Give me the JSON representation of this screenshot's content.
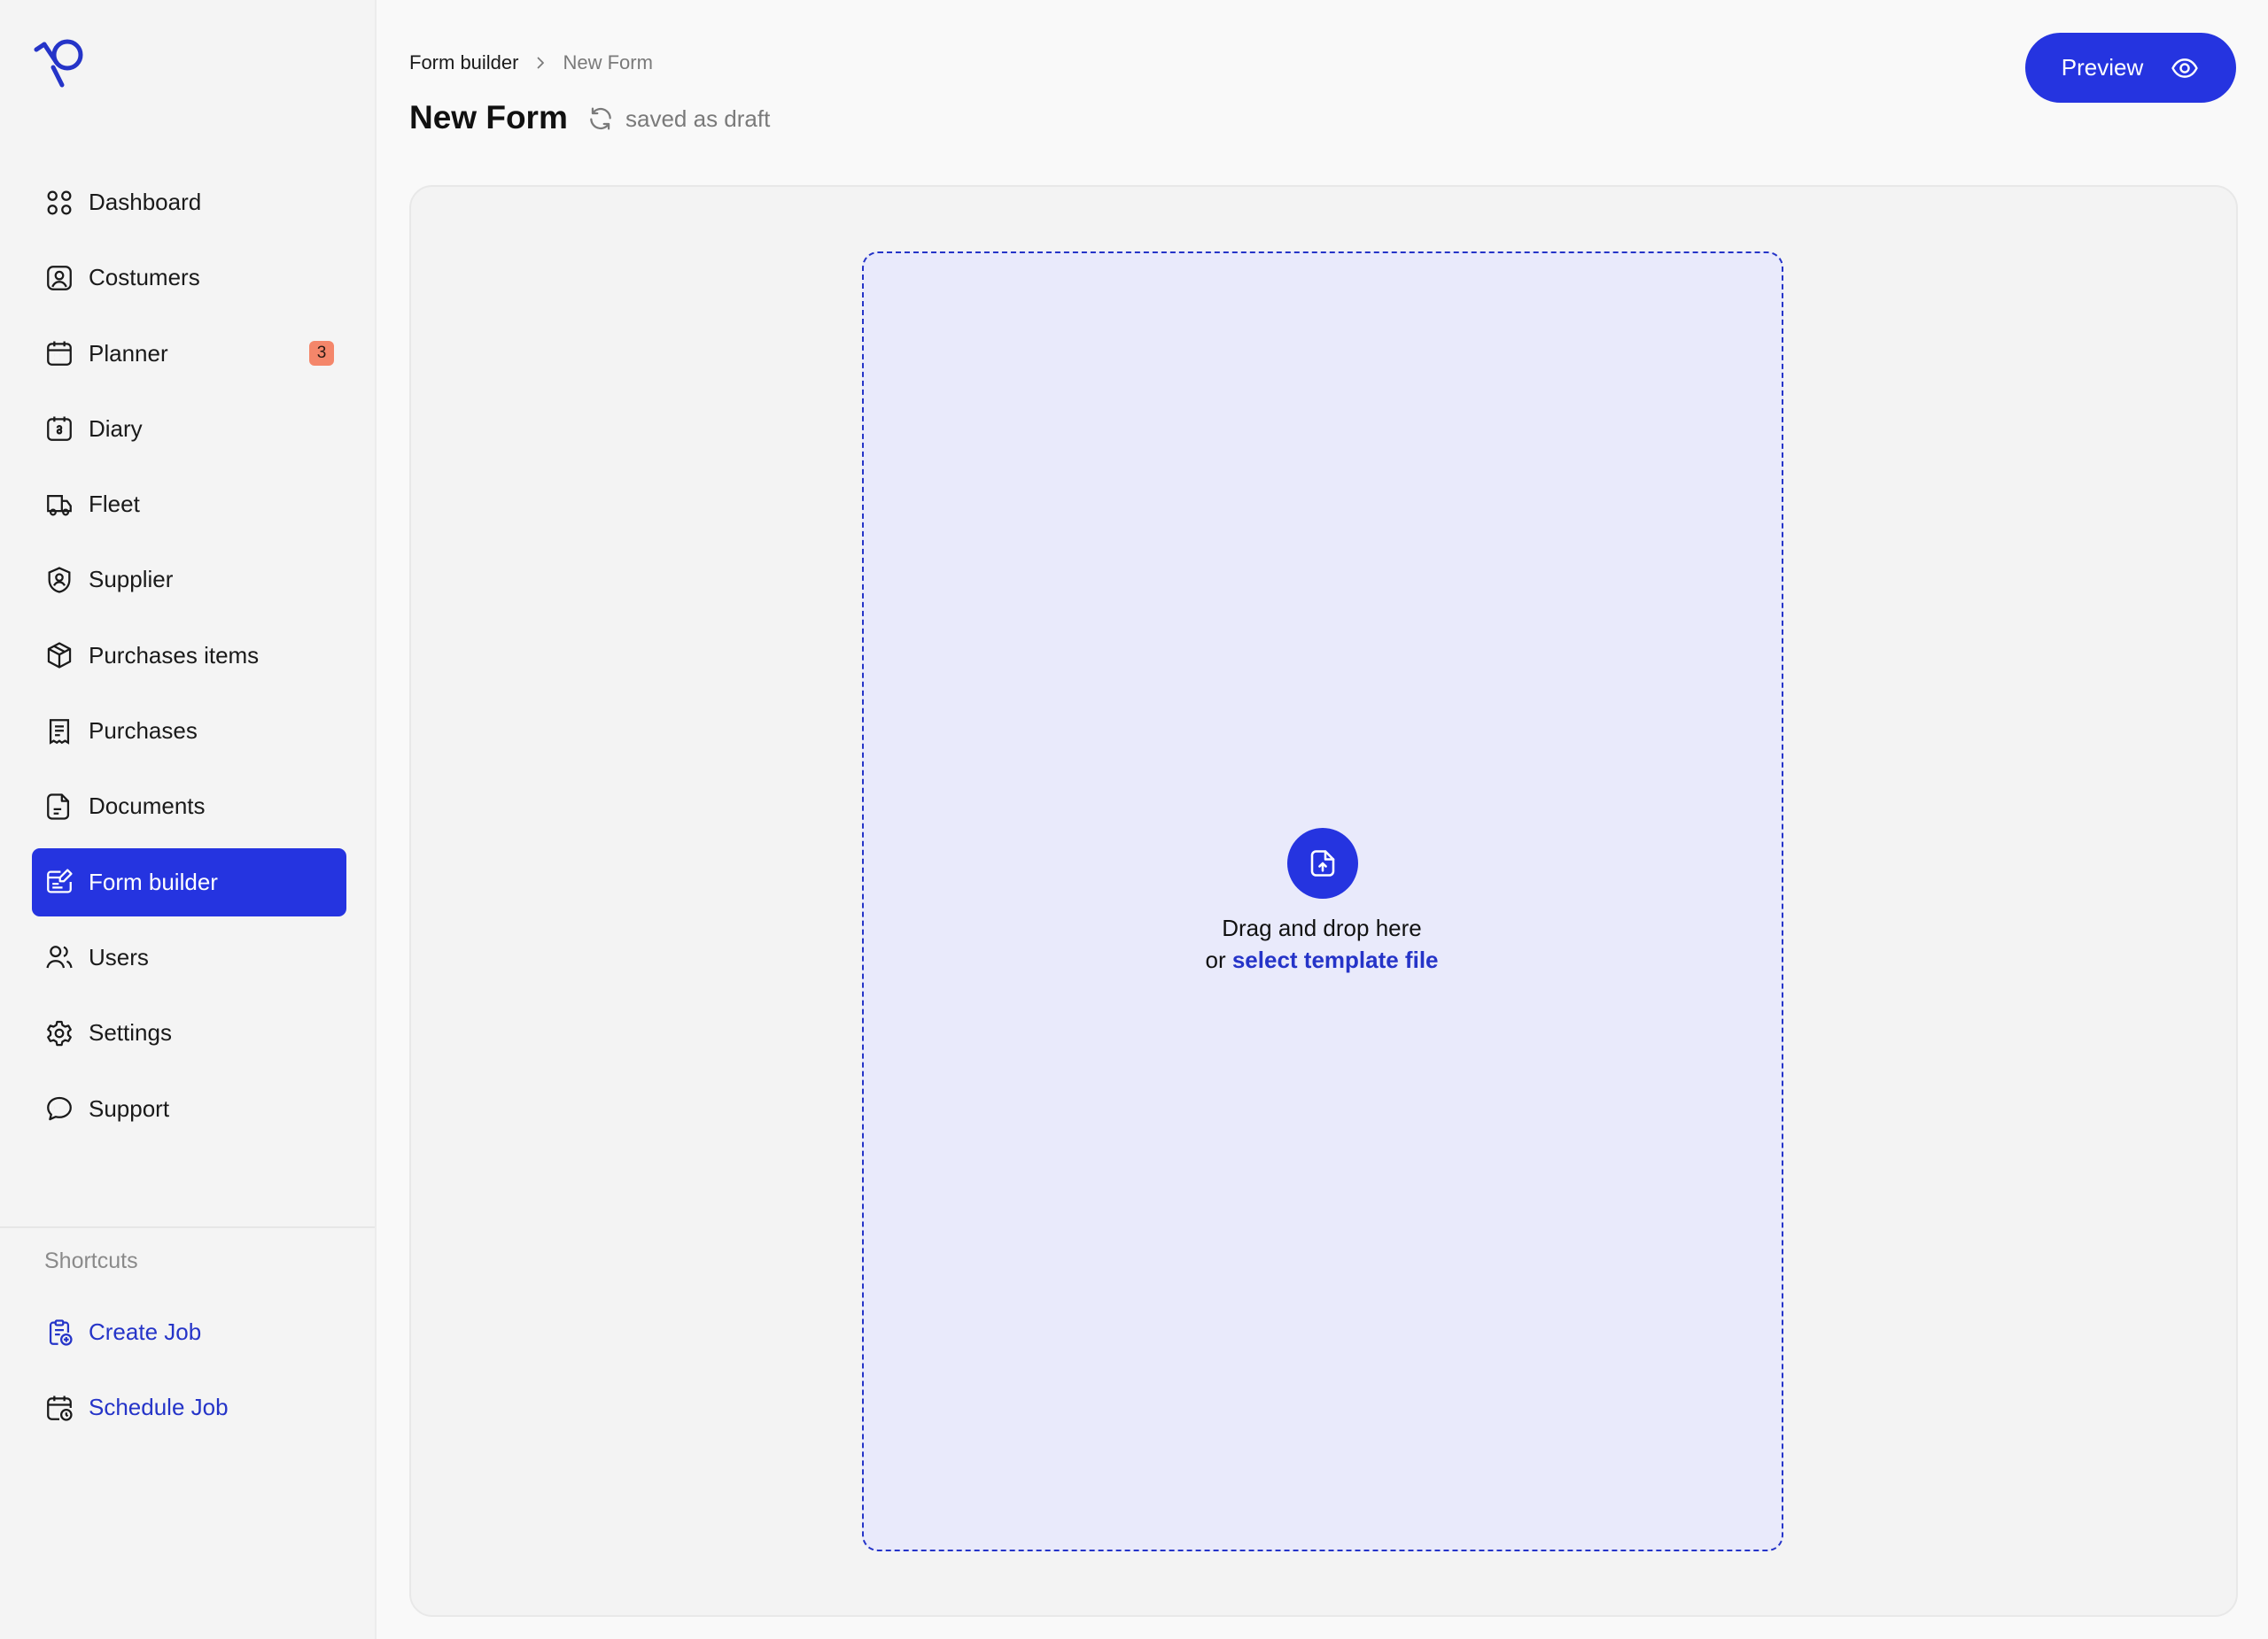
{
  "sidebar": {
    "items": [
      {
        "label": "Dashboard",
        "icon": "dashboard-icon"
      },
      {
        "label": "Costumers",
        "icon": "user-square-icon"
      },
      {
        "label": "Planner",
        "icon": "calendar-icon",
        "badge": "3"
      },
      {
        "label": "Diary",
        "icon": "diary-icon"
      },
      {
        "label": "Fleet",
        "icon": "truck-icon"
      },
      {
        "label": "Supplier",
        "icon": "supplier-shield-icon"
      },
      {
        "label": "Purchases items",
        "icon": "package-icon"
      },
      {
        "label": "Purchases",
        "icon": "receipt-icon"
      },
      {
        "label": "Documents",
        "icon": "document-icon"
      },
      {
        "label": "Form builder",
        "icon": "form-edit-icon",
        "active": true
      },
      {
        "label": "Users",
        "icon": "users-icon"
      },
      {
        "label": "Settings",
        "icon": "gear-icon"
      },
      {
        "label": "Support",
        "icon": "chat-icon"
      }
    ],
    "shortcuts_title": "Shortcuts",
    "shortcuts": [
      {
        "label": "Create Job",
        "icon": "clipboard-add-icon"
      },
      {
        "label": "Schedule Job",
        "icon": "calendar-clock-icon"
      }
    ]
  },
  "header": {
    "breadcrumb": [
      "Form builder",
      "New Form"
    ],
    "title": "New Form",
    "status": "saved as draft",
    "preview_label": "Preview"
  },
  "dropzone": {
    "line1": "Drag and drop here",
    "line2_prefix": "or",
    "link": "select template file"
  },
  "colors": {
    "accent": "#2534e0",
    "link": "#2534c8",
    "badge": "#f4866a",
    "dropzone_bg": "#e9eafb"
  }
}
